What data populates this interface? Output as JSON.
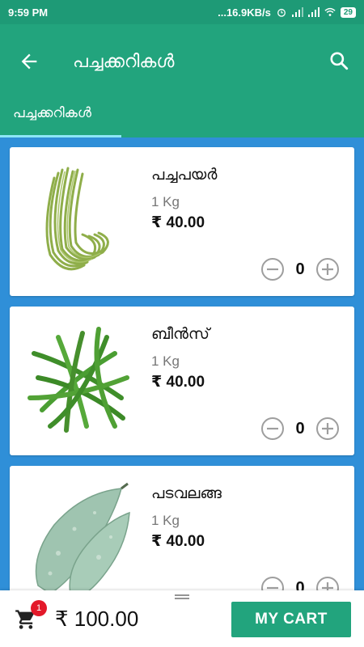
{
  "status": {
    "time": "9:59 PM",
    "net_speed": "...16.9KB/s",
    "battery": "29"
  },
  "header": {
    "title": "പച്ചക്കറികൾ",
    "tabs": [
      {
        "label": "പച്ചക്കറികൾ"
      }
    ]
  },
  "products": [
    {
      "name": "പച്ചപയർ",
      "qty": "1 Kg",
      "price": "₹ 40.00",
      "count": "0"
    },
    {
      "name": "ബീൻസ്",
      "qty": "1 Kg",
      "price": "₹ 40.00",
      "count": "0"
    },
    {
      "name": "പടവലങ്ങ",
      "qty": "1 Kg",
      "price": "₹ 40.00",
      "count": "0"
    }
  ],
  "cart": {
    "badge": "1",
    "total": "₹ 100.00",
    "button_label": "MY CART"
  },
  "colors": {
    "primary": "#22a47d",
    "statusbar": "#1e9a76",
    "background": "#2f8fd8",
    "badge": "#e3192a"
  }
}
